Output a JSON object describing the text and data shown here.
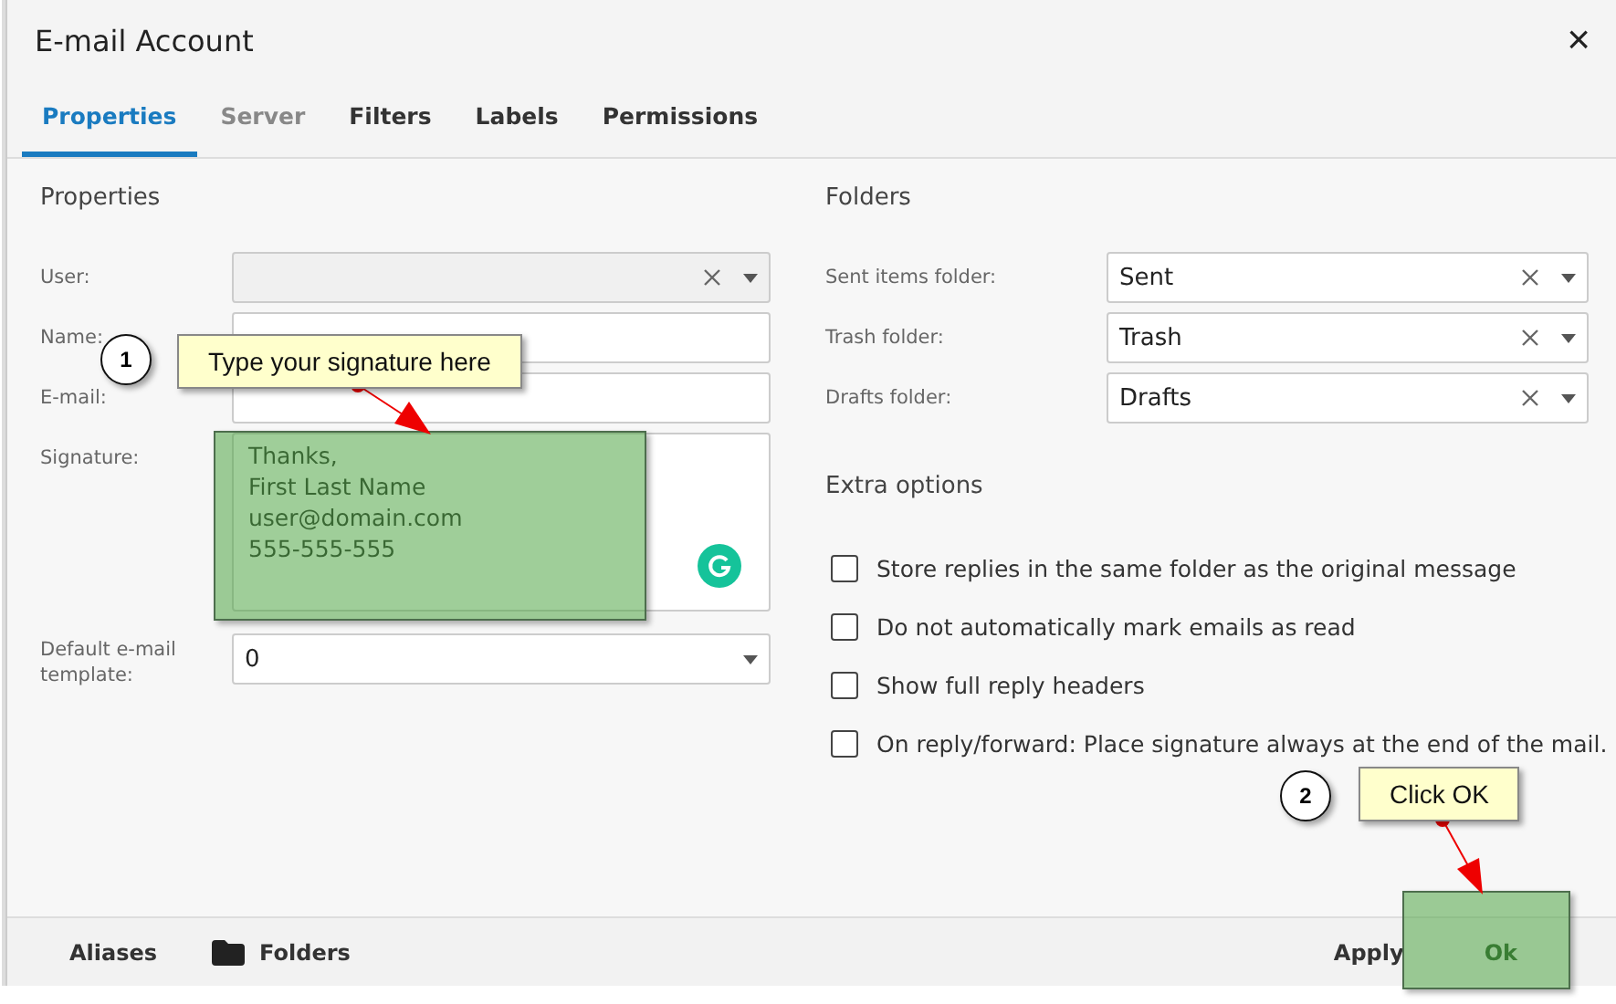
{
  "window": {
    "title": "E-mail Account",
    "close": "×"
  },
  "tabs": [
    {
      "label": "Properties",
      "selected": true,
      "disabled": false
    },
    {
      "label": "Server",
      "selected": false,
      "disabled": true
    },
    {
      "label": "Filters",
      "selected": false,
      "disabled": false
    },
    {
      "label": "Labels",
      "selected": false,
      "disabled": false
    },
    {
      "label": "Permissions",
      "selected": false,
      "disabled": false
    }
  ],
  "properties": {
    "heading": "Properties",
    "fields": [
      {
        "kind": "combo",
        "label": "User:",
        "disabled": true
      },
      {
        "kind": "text",
        "label": "Name:",
        "disabled": false
      },
      {
        "kind": "text",
        "label": "E-mail:",
        "disabled": false
      },
      {
        "kind": "textarea",
        "label": "Signature:",
        "disabled": false,
        "value": "Thanks,\nFirst Last Name\nuser@domain.com\n555-555-555"
      },
      {
        "kind": "select",
        "label": "Default e-mail template:",
        "disabled": false,
        "value": "0"
      }
    ]
  },
  "folders": {
    "heading": "Folders",
    "fields": [
      {
        "label": "Sent items folder:",
        "value": "Sent"
      },
      {
        "label": "Trash folder:",
        "value": "Trash"
      },
      {
        "label": "Drafts folder:",
        "value": "Drafts"
      }
    ]
  },
  "extra_options": {
    "heading": "Extra options",
    "options": [
      {
        "label": "Store replies in the same folder as the original message",
        "checked": false
      },
      {
        "label": "Do not automatically mark emails as read",
        "checked": false
      },
      {
        "label": "Show full reply headers",
        "checked": false
      },
      {
        "label": "On reply/forward: Place signature always at the end of the mail.",
        "checked": false
      }
    ]
  },
  "footer": {
    "links": [
      {
        "label": "Aliases",
        "kind": "plain"
      },
      {
        "label": "Folders",
        "kind": "folder"
      }
    ],
    "buttons": [
      {
        "label": "Apply",
        "kind": "plain"
      },
      {
        "label": "Ok",
        "kind": "primary"
      }
    ]
  },
  "annotations": [
    {
      "number": "1",
      "text": "Type your signature here"
    },
    {
      "number": "2",
      "text": "Click OK"
    }
  ]
}
